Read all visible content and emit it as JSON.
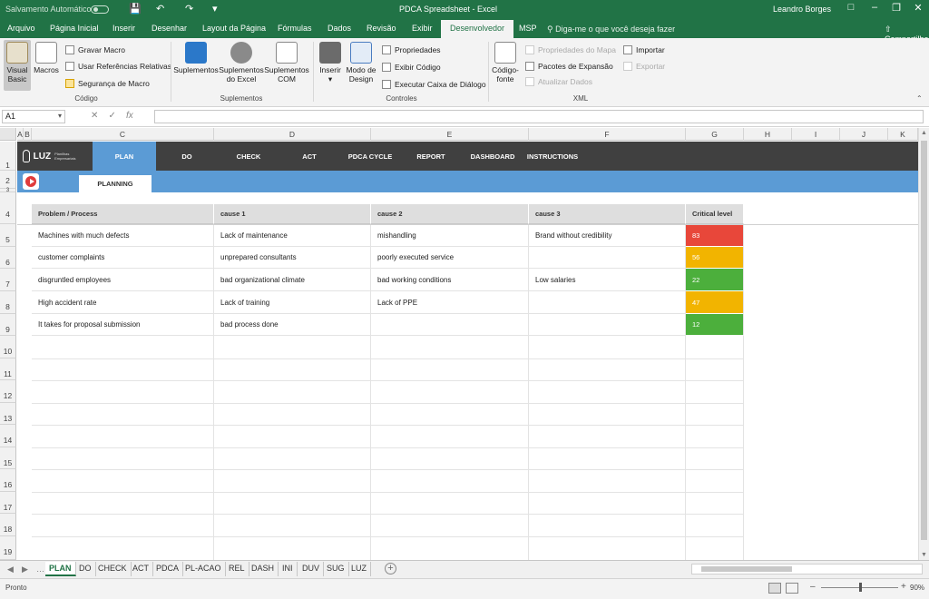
{
  "titlebar": {
    "autosave_label": "Salvamento Automático",
    "doc_title": "PDCA Spreadsheet - Excel",
    "user": "Leandro Borges"
  },
  "ribbon_tabs": [
    "Arquivo",
    "Página Inicial",
    "Inserir",
    "Desenhar",
    "Layout da Página",
    "Fórmulas",
    "Dados",
    "Revisão",
    "Exibir",
    "Desenvolvedor",
    "MSP"
  ],
  "active_tab": "Desenvolvedor",
  "tell_me": "Diga-me o que você deseja fazer",
  "share": "Compartilhar",
  "ribbon": {
    "codigo": {
      "label": "Código",
      "visual_basic": "Visual Basic",
      "macros": "Macros",
      "gravar_macro": "Gravar Macro",
      "usar_referencias": "Usar Referências Relativas",
      "seguranca": "Segurança de Macro"
    },
    "suplementos": {
      "label": "Suplementos",
      "suplementos": "Suplementos",
      "suplementos_excel": "Suplementos do Excel",
      "suplementos_com": "Suplementos COM"
    },
    "controles": {
      "label": "Controles",
      "inserir": "Inserir",
      "modo_design": "Modo de Design",
      "propriedades": "Propriedades",
      "exibir_codigo": "Exibir Código",
      "executar_caixa": "Executar Caixa de Diálogo"
    },
    "xml": {
      "label": "XML",
      "codigo_fonte": "Código-fonte",
      "propriedades_mapa": "Propriedades do Mapa",
      "pacotes_expansao": "Pacotes de Expansão",
      "atualizar_dados": "Atualizar Dados",
      "importar": "Importar",
      "exportar": "Exportar"
    }
  },
  "formula_bar": {
    "name_box": "A1",
    "value": ""
  },
  "columns": [
    "A",
    "B",
    "C",
    "D",
    "E",
    "F",
    "G",
    "H",
    "I",
    "J",
    "K"
  ],
  "rows": [
    "1",
    "2",
    "3",
    "4",
    "5",
    "6",
    "7",
    "8",
    "9",
    "10",
    "11",
    "12",
    "13",
    "14",
    "15",
    "16",
    "17",
    "18",
    "19"
  ],
  "nav": {
    "logo_text": "LUZ",
    "logo_sub": "Planilhas Empresariais",
    "items": [
      "PLAN",
      "DO",
      "CHECK",
      "ACT",
      "PDCA CYCLE",
      "REPORT",
      "DASHBOARD",
      "INSTRUCTIONS"
    ]
  },
  "planning_tab": "PLANNING",
  "table": {
    "headers": [
      "Problem / Process",
      "cause 1",
      "cause 2",
      "cause 3",
      "Critical level"
    ],
    "rows": [
      {
        "problem": "Machines with much defects",
        "cause1": "Lack of maintenance",
        "cause2": "mishandling",
        "cause3": "Brand without credibility",
        "critical": "83",
        "color": "#e8473a"
      },
      {
        "problem": "customer complaints",
        "cause1": "unprepared consultants",
        "cause2": "poorly executed service",
        "cause3": "",
        "critical": "56",
        "color": "#f2b400"
      },
      {
        "problem": "disgruntled employees",
        "cause1": "bad organizational climate",
        "cause2": "bad working conditions",
        "cause3": "Low salaries",
        "critical": "22",
        "color": "#4caf3c"
      },
      {
        "problem": "High accident rate",
        "cause1": "Lack of training",
        "cause2": "Lack of PPE",
        "cause3": "",
        "critical": "47",
        "color": "#f2b400"
      },
      {
        "problem": "It takes for proposal submission",
        "cause1": "bad process done",
        "cause2": "",
        "cause3": "",
        "critical": "12",
        "color": "#4caf3c"
      }
    ]
  },
  "sheet_tabs": [
    "PLAN",
    "DO",
    "CHECK",
    "ACT",
    "PDCA",
    "PL-ACAO",
    "REL",
    "DASH",
    "INI",
    "DUV",
    "SUG",
    "LUZ"
  ],
  "active_sheet": "PLAN",
  "status": {
    "ready": "Pronto",
    "zoom": "90%"
  }
}
